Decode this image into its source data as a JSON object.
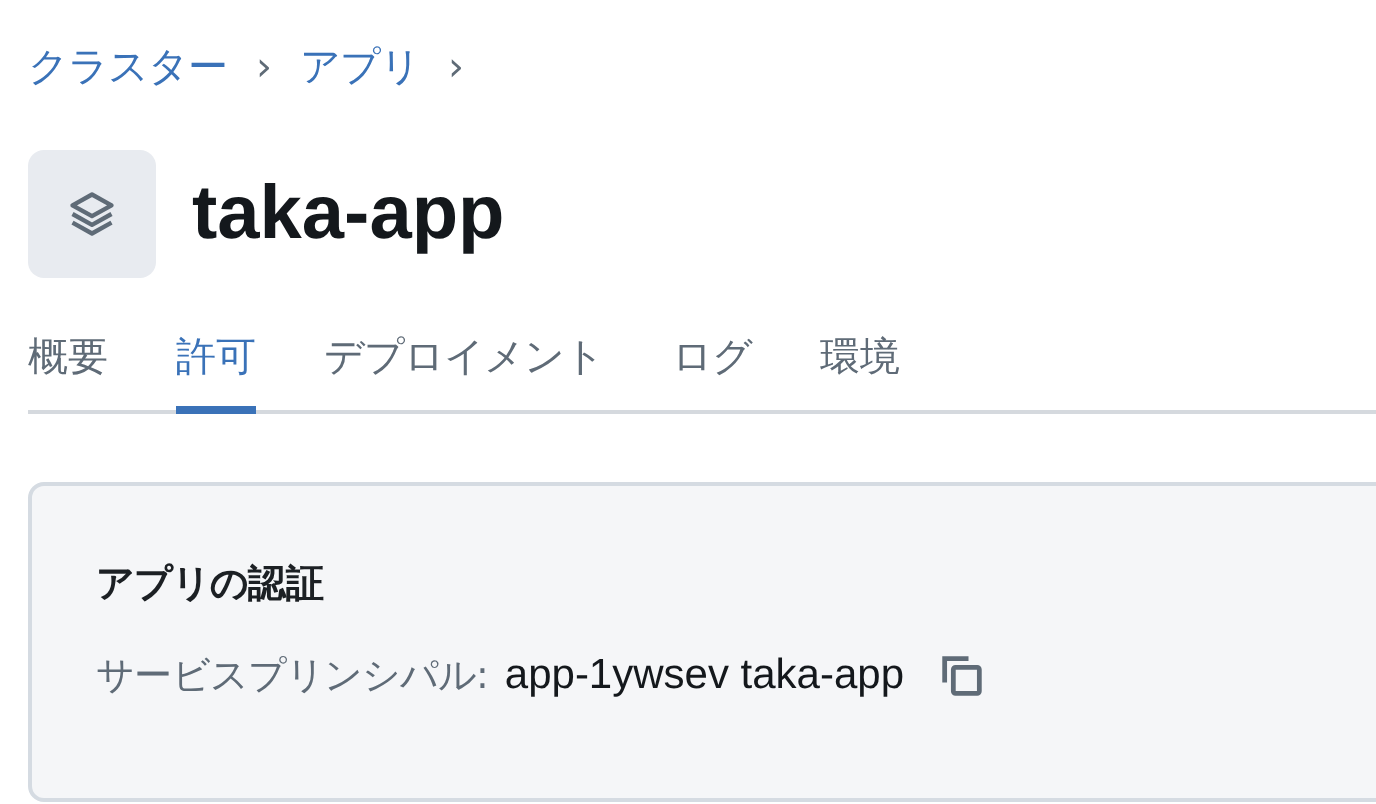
{
  "breadcrumb": [
    {
      "label": "クラスター",
      "separator": "›"
    },
    {
      "label": "アプリ",
      "separator": "›"
    }
  ],
  "app": {
    "title": "taka-app"
  },
  "tabs": [
    {
      "label": "概要",
      "selected": false
    },
    {
      "label": "許可",
      "selected": true
    },
    {
      "label": "デプロイメント",
      "selected": false
    },
    {
      "label": "ログ",
      "selected": false
    },
    {
      "label": "環境",
      "selected": false
    }
  ],
  "card": {
    "title": "アプリの認証",
    "label": "サービスプリンシパル:",
    "value": "app-1ywsev taka-app"
  }
}
